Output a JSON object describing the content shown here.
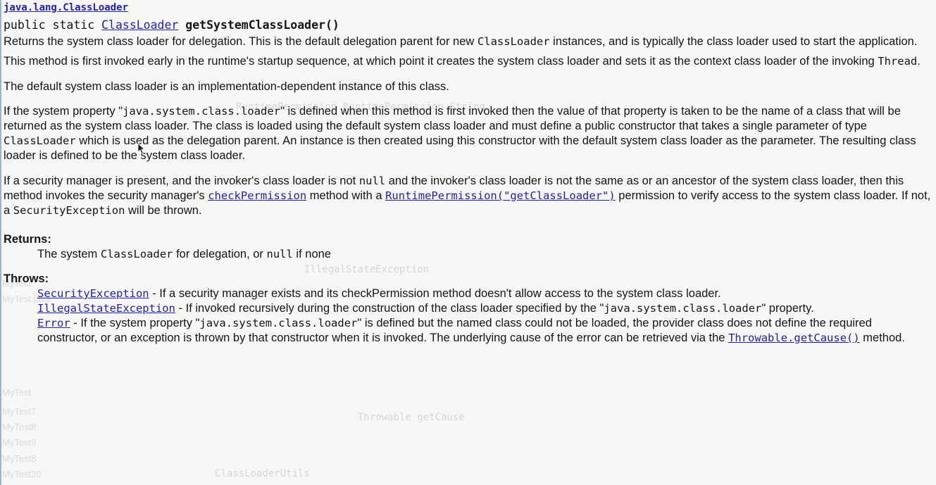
{
  "header": {
    "package_link": "java.lang.ClassLoader",
    "signature_prefix": "public static ",
    "return_type_link": "ClassLoader",
    "method_name": "getSystemClassLoader()"
  },
  "description": {
    "p1": "Returns the system class loader for delegation. This is the default delegation parent for new ",
    "p1_code": "ClassLoader",
    "p1_end": " instances, and is typically the class loader used to start the application.",
    "p2": "This method is first invoked early in the runtime's startup sequence, at which point it creates the system class loader and sets it as the context class loader of the invoking ",
    "p2_code": "Thread",
    "p2_end": ".",
    "p3": "The default system class loader is an implementation-dependent instance of this class.",
    "p4_a": "If the system property \"",
    "p4_code1": "java.system.class.loader",
    "p4_b": "\" is defined when this method is first invoked then the value of that property is taken to be the name of a class that will be returned as the system class loader. The class is loaded using the default system class loader and must define a public constructor that takes a single parameter of type ",
    "p4_code2": "ClassLoader",
    "p4_c": " which is used as the delegation parent. An instance is then created using this constructor with the default system class loader as the parameter. The resulting class loader is defined to be the system class loader.",
    "p5_a": "If a security manager is present, and the invoker's class loader is not ",
    "p5_code1": "null",
    "p5_b": " and the invoker's class loader is not the same as or an ancestor of the system class loader, then this method invokes the security manager's ",
    "p5_link1": "checkPermission",
    "p5_c": " method with a ",
    "p5_link2": "RuntimePermission(\"getClassLoader\")",
    "p5_d": " permission to verify access to the system class loader. If not, a ",
    "p5_code2": "SecurityException",
    "p5_e": " will be thrown."
  },
  "returns": {
    "title": "Returns:",
    "a": "The system ",
    "code1": "ClassLoader",
    "b": " for delegation, or ",
    "code2": "null",
    "c": " if none"
  },
  "throws": {
    "title": "Throws:",
    "items": [
      {
        "link": "SecurityException",
        "text": " - If a security manager exists and its checkPermission method doesn't allow access to the system class loader."
      },
      {
        "link": "IllegalStateException",
        "text_a": " - If invoked recursively during the construction of the class loader specified by the \"",
        "code": "java.system.class.loader",
        "text_b": "\" property."
      },
      {
        "link": "Error",
        "text_a": " - If the system property \"",
        "code": "java.system.class.loader",
        "text_b": "\" is defined but the named class could not be loaded, the provider class does not define the required constructor, or an exception is thrown by that constructor when it is invoked. The underlying cause of the error can be retrieved via the ",
        "link2": "Throwable.getCause()",
        "text_c": " method."
      }
    ]
  }
}
